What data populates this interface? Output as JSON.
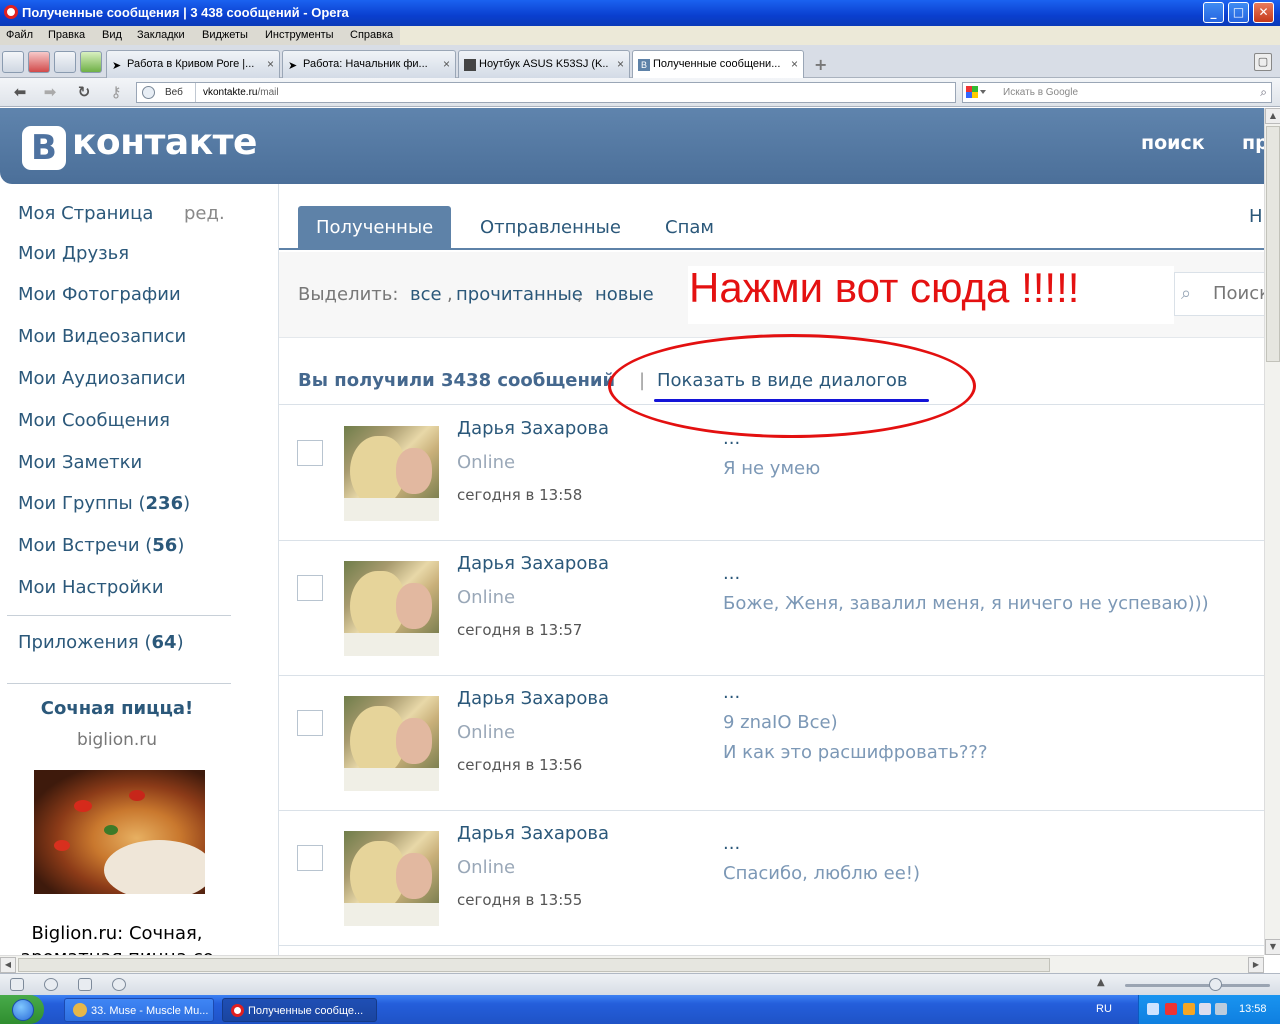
{
  "window": {
    "title": "Полученные сообщения | 3 438 сообщений - Opera"
  },
  "menu": [
    "Файл",
    "Правка",
    "Вид",
    "Закладки",
    "Виджеты",
    "Инструменты",
    "Справка"
  ],
  "tabs": [
    {
      "label": "Работа в Кривом Роге |...",
      "close": "×"
    },
    {
      "label": "Работа: Начальник фи...",
      "close": "×"
    },
    {
      "label": "Ноутбук ASUS K53SJ (K...",
      "close": "×"
    },
    {
      "label": "Полученные сообщени...",
      "close": "×",
      "active": true
    }
  ],
  "address": {
    "mode_label": "Веб",
    "host": "vkontakte.ru",
    "path": "/mail",
    "search_placeholder": "Искать в Google"
  },
  "vk": {
    "logo_letter": "В",
    "logo_text": "контакте",
    "header_links": [
      "поиск",
      "пр"
    ],
    "sidebar": {
      "edit": "ред.",
      "items": [
        {
          "label": "Моя Страница"
        },
        {
          "label": "Мои Друзья"
        },
        {
          "label": "Мои Фотографии"
        },
        {
          "label": "Мои Видеозаписи"
        },
        {
          "label": "Мои Аудиозаписи"
        },
        {
          "label": "Мои Сообщения"
        },
        {
          "label": "Мои Заметки"
        },
        {
          "label": "Мои Группы",
          "count": "236"
        },
        {
          "label": "Мои Встречи",
          "count": "56"
        },
        {
          "label": "Мои Настройки"
        }
      ],
      "apps": {
        "label": "Приложения",
        "count": "64"
      }
    },
    "ad": {
      "title": "Сочная пицца!",
      "domain": "biglion.ru",
      "text_line1": "Biglion.ru: Сочная,",
      "text_line2": "ароматная пицца со"
    },
    "mail_tabs": {
      "received": "Полученные",
      "sent": "Отправленные",
      "spam": "Спам",
      "new": "Н"
    },
    "select": {
      "label": "Выделить:",
      "all": "все",
      "read": "прочитанные",
      "new": "новые"
    },
    "search_placeholder": "Поиск",
    "annotation": "Нажми вот сюда !!!!!",
    "summary": "Вы получили 3438 сообщений",
    "summary_sep": "|",
    "show_dialogs": "Показать в виде диалогов",
    "messages": [
      {
        "sender": "Дарья Захарова",
        "status": "Online",
        "date": "сегодня в 13:58",
        "subject": "...",
        "lines": [
          "Я не умею"
        ]
      },
      {
        "sender": "Дарья Захарова",
        "status": "Online",
        "date": "сегодня в 13:57",
        "subject": "...",
        "lines": [
          "Боже, Женя, завалил меня, я ничего не успеваю)))"
        ]
      },
      {
        "sender": "Дарья Захарова",
        "status": "Online",
        "date": "сегодня в 13:56",
        "subject": "...",
        "lines": [
          "9 znaIO Все)",
          "И как это расшифровать???"
        ]
      },
      {
        "sender": "Дарья Захарова",
        "status": "Online",
        "date": "сегодня в 13:55",
        "subject": "...",
        "lines": [
          "Спасибо, люблю ее!)"
        ]
      }
    ]
  },
  "taskbar": {
    "tasks": [
      "33. Muse - Muscle Mu...",
      "Полученные сообще..."
    ],
    "lang": "RU",
    "clock": "13:58"
  },
  "colors": {
    "vk_blue": "#5e82a8",
    "link": "#2b587a",
    "annotation_red": "#e41111",
    "underline_blue": "#1414d8"
  }
}
